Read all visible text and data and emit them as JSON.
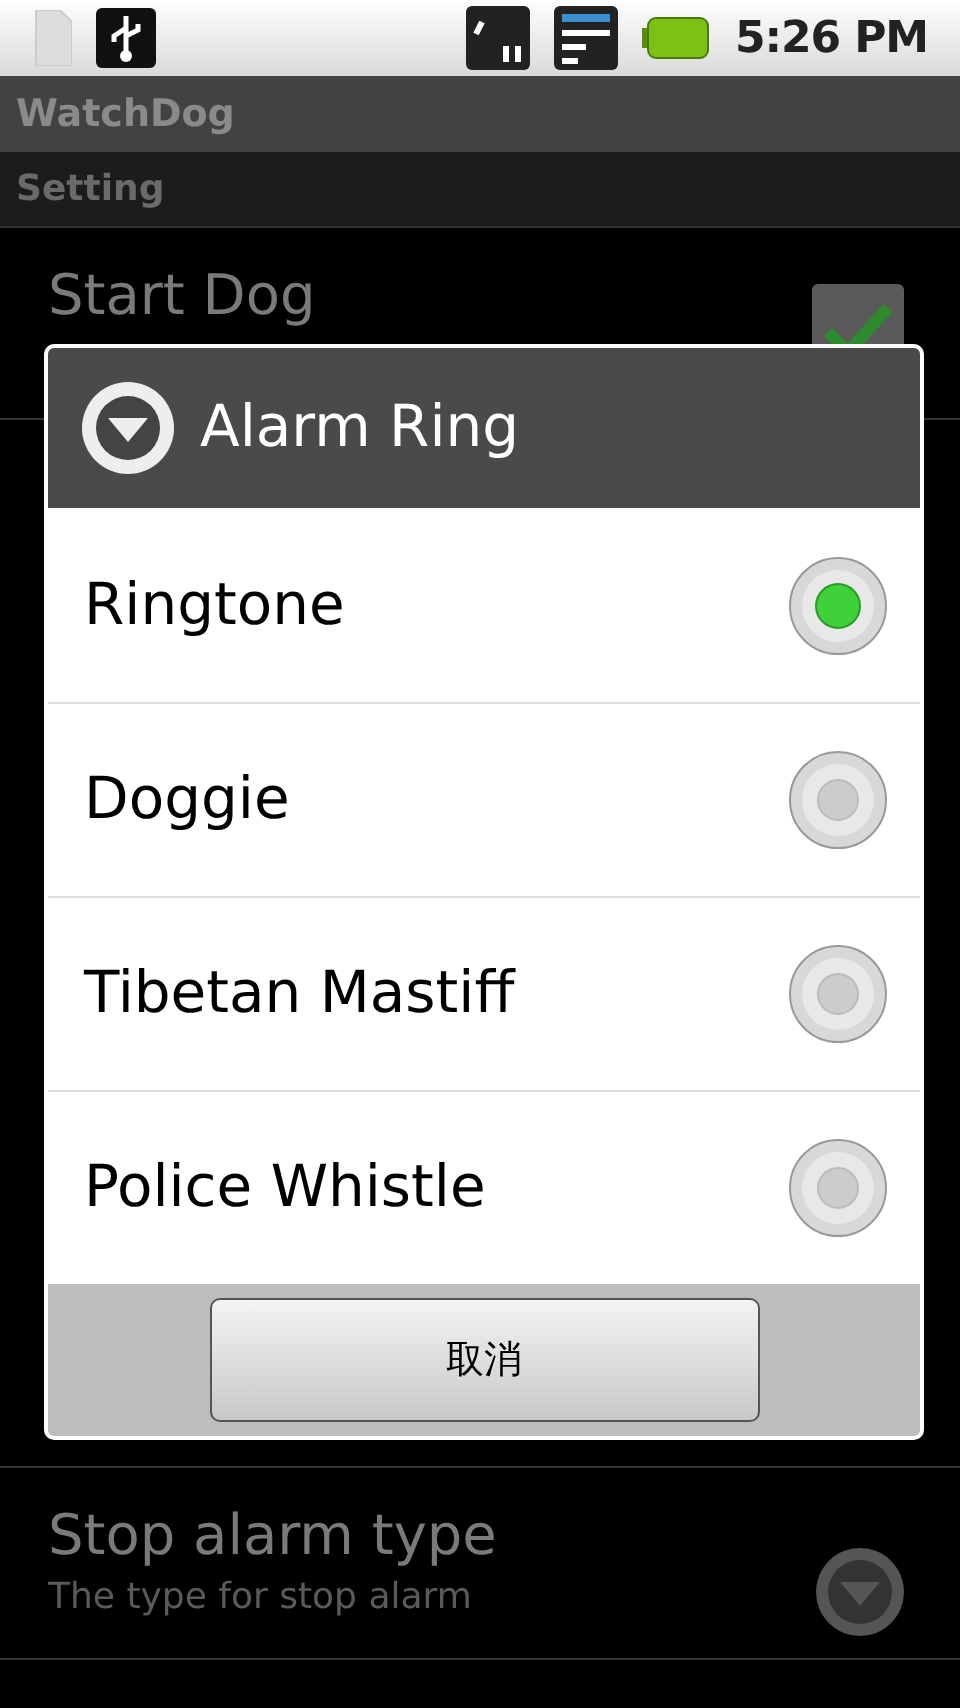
{
  "status_bar": {
    "time": "5:26 PM"
  },
  "app_title": "WatchDog",
  "section_header": "Setting",
  "settings": [
    {
      "title": "Start Dog",
      "kind": "checkbox",
      "checked": true
    },
    {
      "title": "Stop alarm type",
      "summary": "The type for stop alarm",
      "kind": "list"
    }
  ],
  "dialog": {
    "title": "Alarm Ring",
    "options": [
      {
        "label": "Ringtone",
        "selected": true
      },
      {
        "label": "Doggie",
        "selected": false
      },
      {
        "label": "Tibetan Mastiff",
        "selected": false
      },
      {
        "label": "Police Whistle",
        "selected": false
      }
    ],
    "cancel_button": "取消"
  }
}
